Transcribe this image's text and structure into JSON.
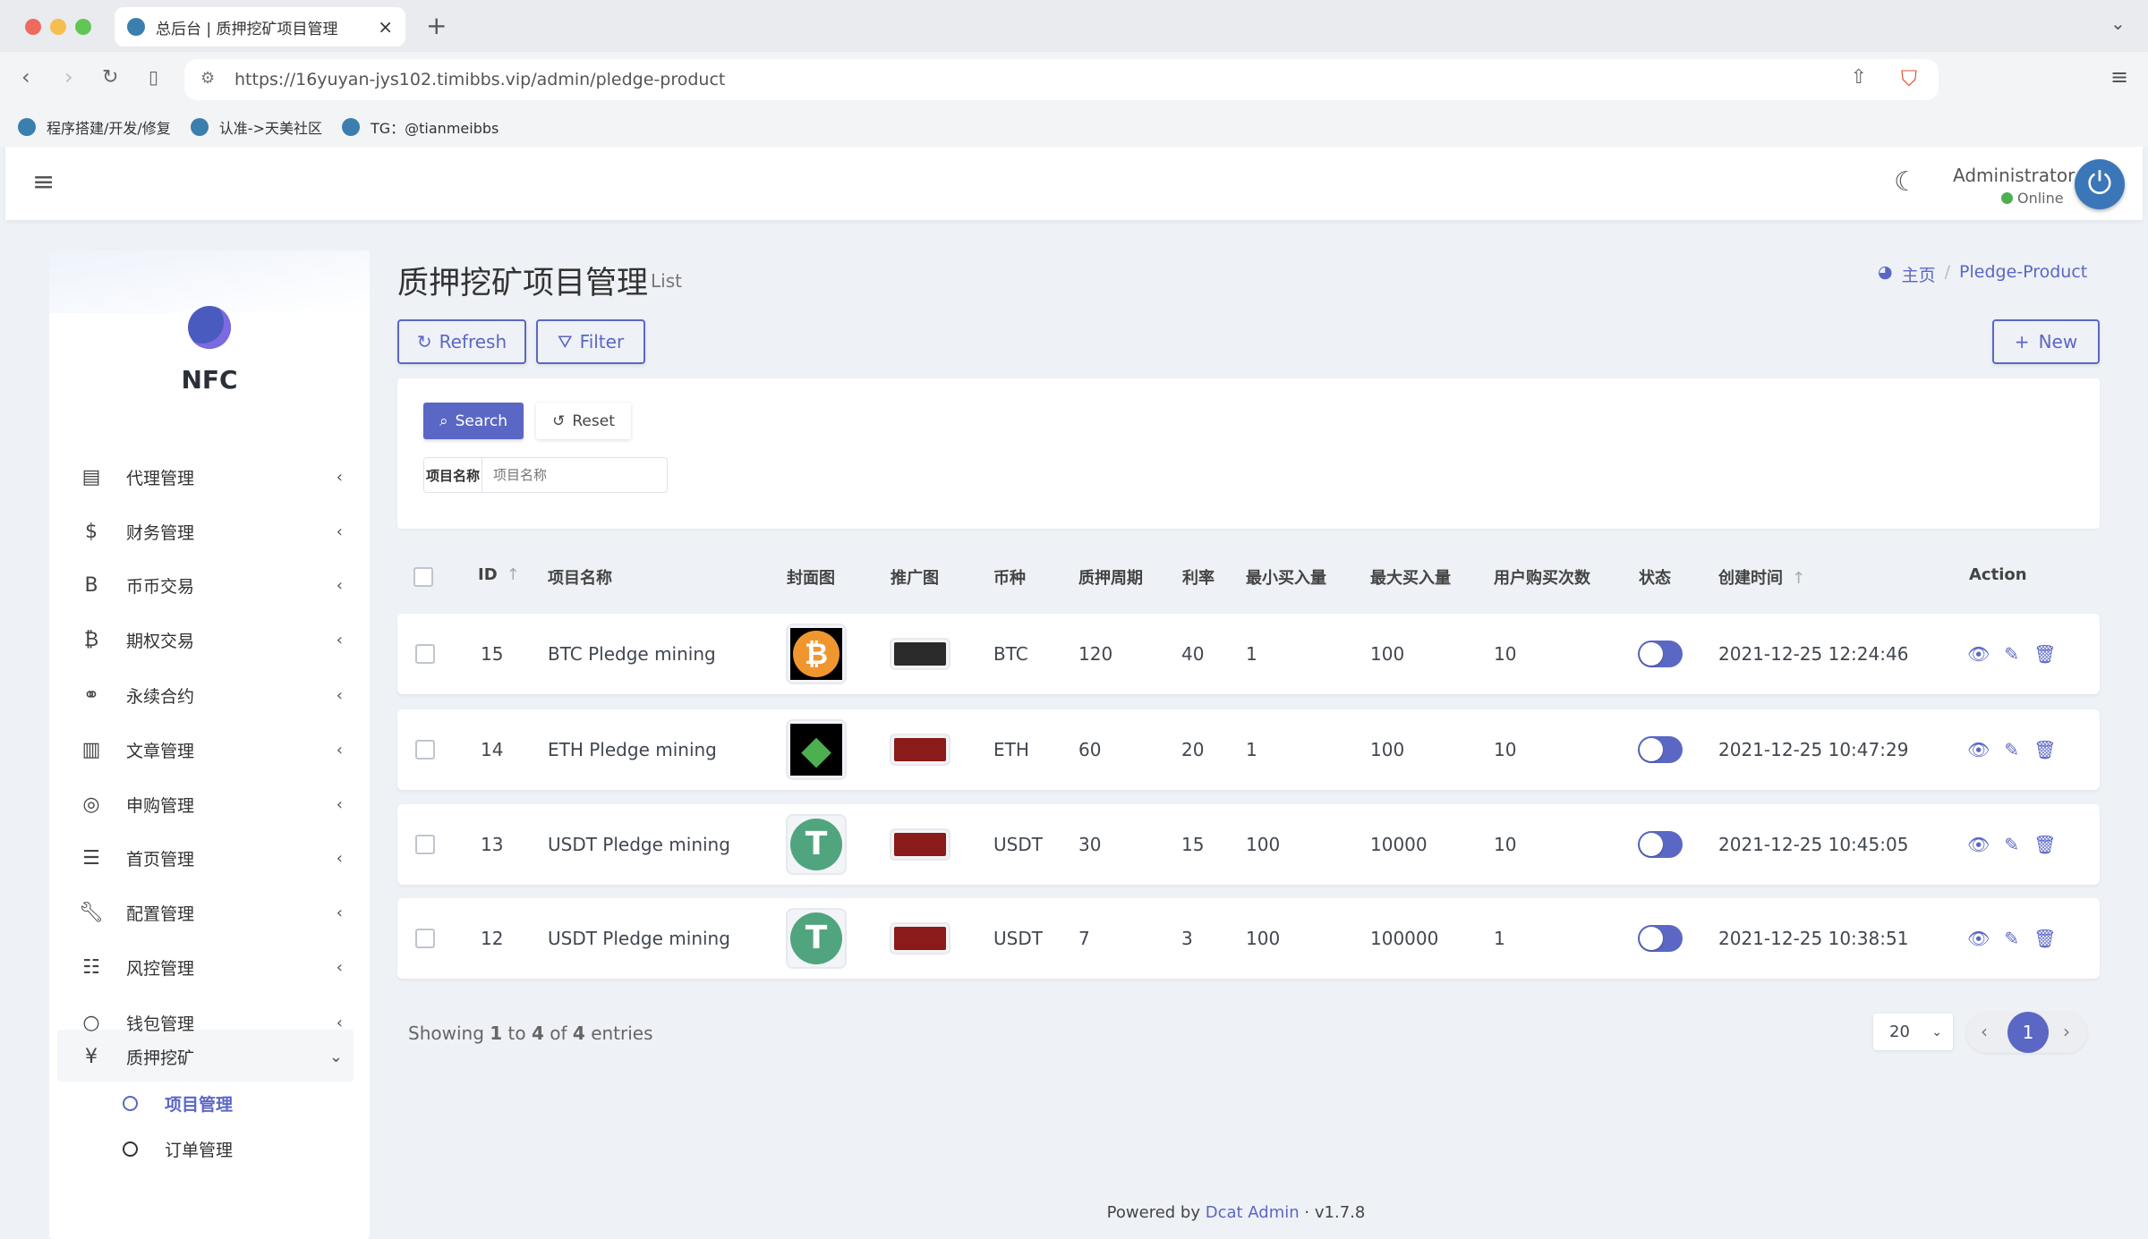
{
  "browser": {
    "tab_title": "总后台 | 质押挖矿项目管理",
    "url": "https://16yuyan-jys102.timibbs.vip/admin/pledge-product",
    "bookmarks": [
      "程序搭建/开发/修复",
      "认准->天美社区",
      "TG：@tianmeibbs"
    ]
  },
  "header": {
    "user": "Administrator",
    "status": "Online",
    "status_color": "#4caf50"
  },
  "sidebar": {
    "brand": "NFC",
    "items": [
      {
        "label": "代理管理",
        "icon": "id-card-icon"
      },
      {
        "label": "财务管理",
        "icon": "dollar-icon"
      },
      {
        "label": "币币交易",
        "icon": "bold-b-icon"
      },
      {
        "label": "期权交易",
        "icon": "bitcoin-icon"
      },
      {
        "label": "永续合约",
        "icon": "link-icon"
      },
      {
        "label": "文章管理",
        "icon": "newspaper-icon"
      },
      {
        "label": "申购管理",
        "icon": "lifebuoy-icon"
      },
      {
        "label": "首页管理",
        "icon": "bars-icon"
      },
      {
        "label": "配置管理",
        "icon": "wrench-icon"
      },
      {
        "label": "风控管理",
        "icon": "list-icon"
      },
      {
        "label": "钱包管理",
        "icon": "circle-icon"
      },
      {
        "label": "质押挖矿",
        "icon": "yen-icon"
      }
    ],
    "subitems": [
      {
        "label": "项目管理",
        "active": true
      },
      {
        "label": "订单管理",
        "active": false
      }
    ]
  },
  "page": {
    "title": "质押挖矿项目管理",
    "subtitle": "List",
    "breadcrumb": [
      "主页",
      "Pledge-Product"
    ],
    "refresh": "Refresh",
    "filter": "Filter",
    "new": "New"
  },
  "filter": {
    "search": "Search",
    "reset": "Reset",
    "field_label": "项目名称",
    "field_placeholder": "项目名称",
    "field_value": ""
  },
  "table": {
    "columns": [
      "ID",
      "项目名称",
      "封面图",
      "推广图",
      "币种",
      "质押周期",
      "利率",
      "最小买入量",
      "最大买入量",
      "用户购买次数",
      "状态",
      "创建时间",
      "Action"
    ],
    "rows": [
      {
        "id": "15",
        "name": "BTC Pledge mining",
        "cover": "btc",
        "coin": "BTC",
        "period": "120",
        "rate": "40",
        "min": "1",
        "max": "100",
        "count": "10",
        "status": true,
        "created": "2021-12-25 12:24:46"
      },
      {
        "id": "14",
        "name": "ETH Pledge mining",
        "cover": "eth",
        "coin": "ETH",
        "period": "60",
        "rate": "20",
        "min": "1",
        "max": "100",
        "count": "10",
        "status": true,
        "created": "2021-12-25 10:47:29"
      },
      {
        "id": "13",
        "name": "USDT Pledge mining",
        "cover": "usdt",
        "coin": "USDT",
        "period": "30",
        "rate": "15",
        "min": "100",
        "max": "10000",
        "count": "10",
        "status": true,
        "created": "2021-12-25 10:45:05"
      },
      {
        "id": "12",
        "name": "USDT Pledge mining",
        "cover": "usdt",
        "coin": "USDT",
        "period": "7",
        "rate": "3",
        "min": "100",
        "max": "100000",
        "count": "1",
        "status": true,
        "created": "2021-12-25 10:38:51"
      }
    ]
  },
  "pagination": {
    "showing_prefix": "Showing",
    "from": "1",
    "to_word": "to",
    "to": "4",
    "of_word": "of",
    "total": "4",
    "entries_word": "entries",
    "per_page": "20",
    "current": "1"
  },
  "footer": {
    "powered": "Powered by",
    "link": "Dcat Admin",
    "version": "v1.7.8"
  },
  "colors": {
    "accent": "#5b67c4",
    "background": "#eef1f6"
  }
}
